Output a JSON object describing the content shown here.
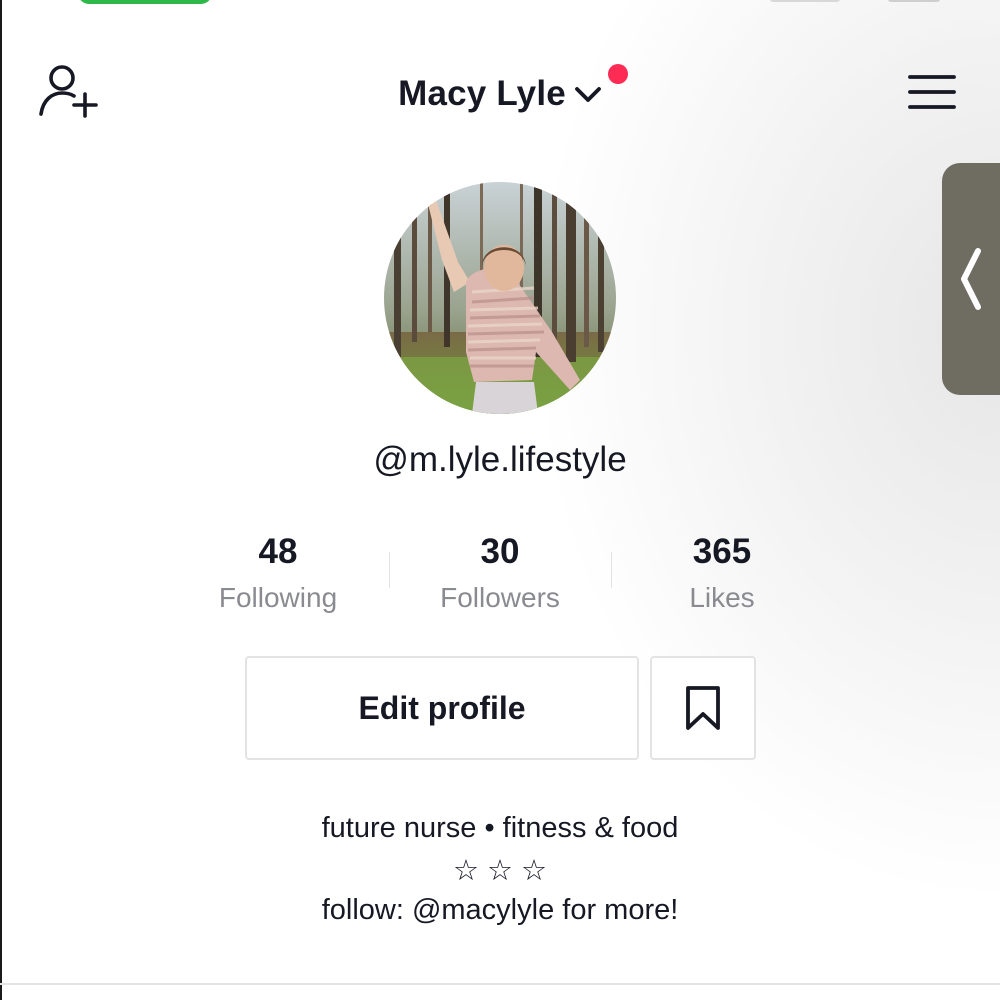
{
  "header": {
    "title": "Macy Lyle",
    "has_notification": true,
    "notification_color": "#fe2c55",
    "left_icon": "add-user-icon",
    "right_icon": "hamburger-menu-icon",
    "title_icon": "chevron-down-icon"
  },
  "profile": {
    "username": "@m.lyle.lifestyle",
    "avatar": "avatar-photo-woman-in-forest"
  },
  "stats": [
    {
      "value": "48",
      "label": "Following"
    },
    {
      "value": "30",
      "label": "Followers"
    },
    {
      "value": "365",
      "label": "Likes"
    }
  ],
  "actions": {
    "edit_profile": "Edit profile",
    "bookmark_icon": "bookmark-icon"
  },
  "bio": {
    "line1": "future nurse • fitness & food",
    "line2": "☆ ☆ ☆",
    "line3": "follow: @macylyle for more!"
  },
  "side_tab_icon": "chevron-left-icon",
  "colors": {
    "text": "#161823",
    "secondary_text": "#8a8b91",
    "accent": "#fe2c55",
    "border": "#e3e3e4",
    "side_tab": "#6f6c61"
  }
}
